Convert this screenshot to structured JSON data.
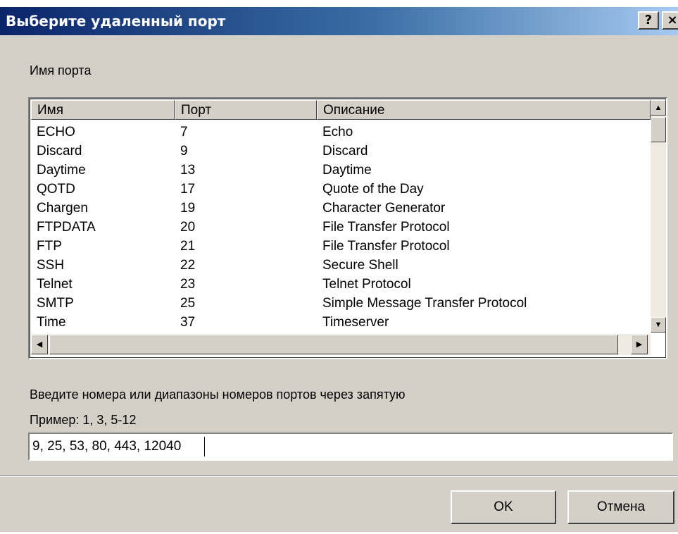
{
  "window": {
    "title": "Выберите удаленный порт",
    "help_label": "?",
    "close_label": "×"
  },
  "port_name_label": "Имя порта",
  "table": {
    "columns": [
      "Имя",
      "Порт",
      "Описание"
    ],
    "rows": [
      [
        "ECHO",
        "7",
        "Echo"
      ],
      [
        "Discard",
        "9",
        "Discard"
      ],
      [
        "Daytime",
        "13",
        "Daytime"
      ],
      [
        "QOTD",
        "17",
        "Quote of the Day"
      ],
      [
        "Chargen",
        "19",
        "Character Generator"
      ],
      [
        "FTPDATA",
        "20",
        "File Transfer Protocol"
      ],
      [
        "FTP",
        "21",
        "File Transfer Protocol"
      ],
      [
        "SSH",
        "22",
        "Secure Shell"
      ],
      [
        "Telnet",
        "23",
        "Telnet Protocol"
      ],
      [
        "SMTP",
        "25",
        "Simple Message Transfer Protocol"
      ],
      [
        "Time",
        "37",
        "Timeserver"
      ]
    ]
  },
  "instructions": "Введите номера или диапазоны номеров портов через запятую",
  "example": "Пример: 1, 3, 5-12",
  "ports_input": {
    "value": "9, 25, 53, 80, 443, 12040"
  },
  "buttons": {
    "ok": "OK",
    "cancel": "Отмена"
  },
  "icons": {
    "scroll_up": "scroll-up-arrow-icon",
    "scroll_down": "scroll-down-arrow-icon",
    "scroll_left": "scroll-left-arrow-icon",
    "scroll_right": "scroll-right-arrow-icon"
  }
}
